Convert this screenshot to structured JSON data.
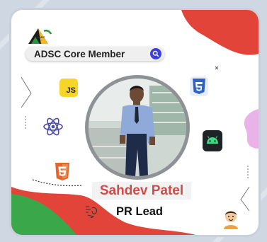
{
  "logo": {
    "text": "ADSC"
  },
  "membership": {
    "label": "ADSC Core Member"
  },
  "profile": {
    "name": "Sahdev Patel",
    "role": "PR Lead"
  },
  "badges": {
    "js": "JS"
  },
  "colors": {
    "accent_red": "#e2443a",
    "accent_green": "#3aa84a",
    "pill_icon": "#3b3fe0",
    "name_text": "#d24a4a",
    "js_yellow": "#f5d52a",
    "css_blue": "#2f62c8",
    "html_orange": "#e2662f",
    "android_green": "#3ddc84",
    "react_purple": "#4a4aa8",
    "pink": "#e9b3e9"
  },
  "icons": [
    "adsc-logo-icon",
    "search-icon",
    "js-icon",
    "css3-icon",
    "react-icon",
    "android-icon",
    "html5-icon",
    "sketch-doodle-icon",
    "cartoon-avatar-icon"
  ]
}
